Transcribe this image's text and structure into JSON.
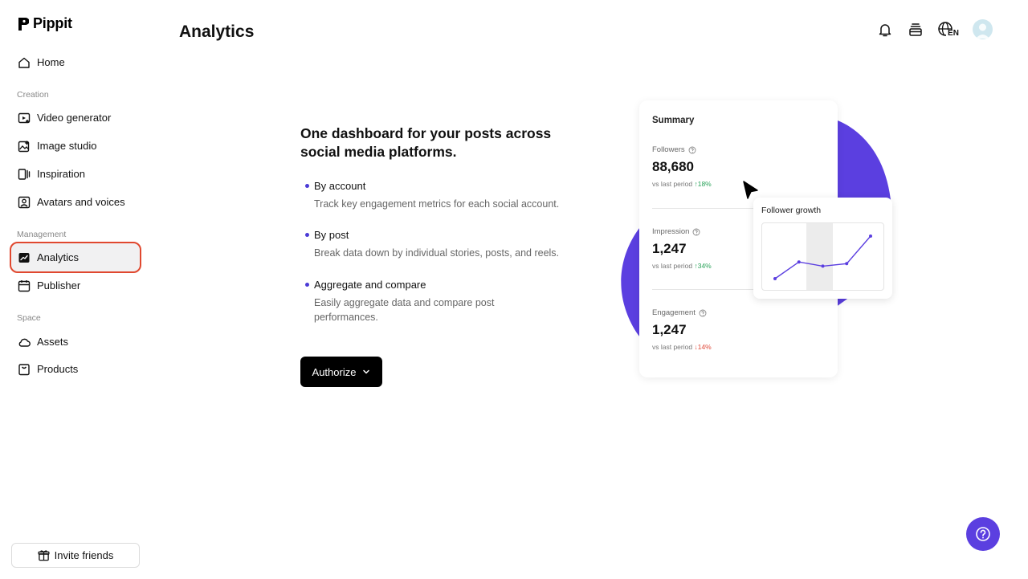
{
  "app": {
    "name": "Pippit"
  },
  "sidebar": {
    "home": "Home",
    "sections": {
      "creation": "Creation",
      "management": "Management",
      "space": "Space"
    },
    "items": {
      "video_generator": "Video generator",
      "image_studio": "Image studio",
      "inspiration": "Inspiration",
      "avatars_voices": "Avatars and voices",
      "analytics": "Analytics",
      "publisher": "Publisher",
      "assets": "Assets",
      "products": "Products"
    },
    "active_item": "Analytics",
    "invite_label": "Invite friends"
  },
  "header": {
    "title": "Analytics",
    "language_badge": "EN",
    "icons": [
      "bell-icon",
      "layers-icon",
      "globe-icon",
      "avatar"
    ]
  },
  "main": {
    "headline": "One dashboard for your posts across social media platforms.",
    "features": [
      {
        "title": "By account",
        "desc": "Track key engagement metrics for each social account."
      },
      {
        "title": "By post",
        "desc": "Break data down by individual stories, posts, and reels."
      },
      {
        "title": "Aggregate and compare",
        "desc": "Easily aggregate data and compare post performances."
      }
    ],
    "authorize_label": "Authorize"
  },
  "illustration": {
    "summary_title": "Summary",
    "metrics": [
      {
        "label": "Followers",
        "value": "88,680",
        "compare": "vs last period",
        "change": "18%",
        "direction": "up"
      },
      {
        "label": "Impression",
        "value": "1,247",
        "compare": "vs last period",
        "change": "34%",
        "direction": "up"
      },
      {
        "label": "Engagement",
        "value": "1,247",
        "compare": "vs last period",
        "change": "14%",
        "direction": "down"
      }
    ],
    "growth_title": "Follower growth",
    "growth_points": [
      2,
      22,
      17,
      20,
      53
    ],
    "accent_color": "#5b3fe0",
    "up_color": "#2aa35a",
    "down_color": "#e04a3a"
  },
  "colors": {
    "active_outline": "#e0482f",
    "button_bg": "#000000",
    "help_bg": "#5b3fe0"
  }
}
